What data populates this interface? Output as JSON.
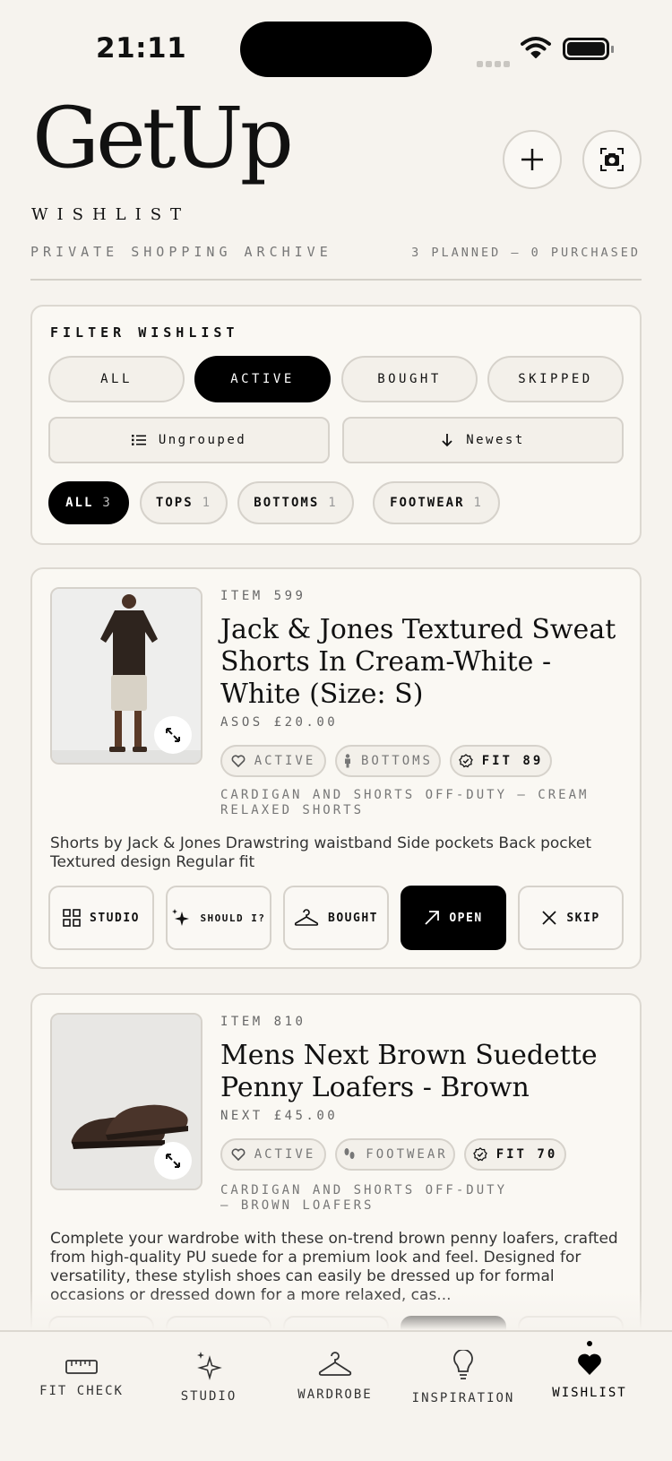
{
  "status": {
    "time": "21:11"
  },
  "header": {
    "brand": "GetUp",
    "subtitle": "WISHLIST",
    "archive": "PRIVATE SHOPPING ARCHIVE",
    "counts": "3 PLANNED — 0 PURCHASED"
  },
  "filter": {
    "title": "FILTER WISHLIST",
    "status_options": [
      "ALL",
      "ACTIVE",
      "BOUGHT",
      "SKIPPED"
    ],
    "selected_status": "ACTIVE",
    "group_label": "Ungrouped",
    "sort_label": "Newest",
    "categories": [
      {
        "label": "ALL",
        "count": "3"
      },
      {
        "label": "TOPS",
        "count": "1"
      },
      {
        "label": "BOTTOMS",
        "count": "1"
      },
      {
        "label": "FOOTWEAR",
        "count": "1"
      }
    ],
    "selected_category": "ALL"
  },
  "items": [
    {
      "number": "ITEM 599",
      "title": "Jack & Jones Textured Sweat Shorts In Cream-White - White (Size: S)",
      "price": "ASOS  £20.00",
      "status": "ACTIVE",
      "category": "BOTTOMS",
      "fit": "FIT 89",
      "outfit": "CARDIGAN AND SHORTS OFF-DUTY — CREAM RELAXED SHORTS",
      "description": "Shorts by Jack & Jones Drawstring waistband Side pockets Back pocket Textured design Regular fit",
      "actions": [
        "STUDIO",
        "SHOULD I?",
        "BOUGHT",
        "OPEN",
        "SKIP"
      ]
    },
    {
      "number": "ITEM 810",
      "title": "Mens Next Brown Suedette Penny Loafers - Brown",
      "price": "NEXT  £45.00",
      "status": "ACTIVE",
      "category": "FOOTWEAR",
      "fit": "FIT 70",
      "outfit": "CARDIGAN AND SHORTS OFF-DUTY — BROWN LOAFERS",
      "description": "Complete your wardrobe with these on-trend brown penny loafers, crafted from high-quality PU suede for a premium look and feel. Designed for versatility, these stylish shoes can easily be dressed up for formal occasions or dressed down for a more relaxed, cas..."
    }
  ],
  "nav": {
    "items": [
      "FIT CHECK",
      "STUDIO",
      "WARDROBE",
      "INSPIRATION",
      "WISHLIST"
    ],
    "active": "WISHLIST"
  },
  "colors": {
    "accent": "#000000",
    "background": "#f6f3ee",
    "card": "#faf8f3",
    "border": "#d6d2cb"
  }
}
